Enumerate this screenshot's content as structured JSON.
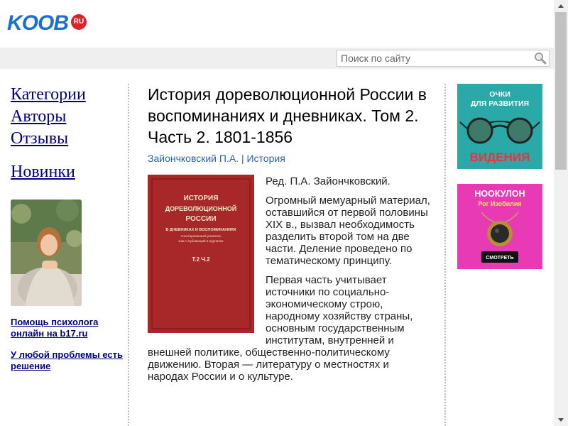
{
  "header": {
    "logo_text": "KOOB",
    "logo_badge": "RU",
    "search_placeholder": "Поиск по сайту"
  },
  "nav": {
    "items": [
      "Категории",
      "Авторы",
      "Отзывы"
    ],
    "new_label": "Новинки"
  },
  "promo": {
    "link1": "Помощь психолога онлайн на b17.ru",
    "link2": "У любой проблемы есть решение"
  },
  "book": {
    "title": "История дореволюционной России в воспоминаниях и дневниках. Том 2. Часть 2. 1801-1856",
    "author": "Зайончковский П.А.",
    "separator": "|",
    "category": "История",
    "cover_lines": [
      "ИСТОРИЯ",
      "ДОРЕВОЛЮЦИОННОЙ",
      "РОССИИ",
      "В ДНЕВНИКАХ И ВОСПОМИНАНИЯХ",
      "Аннотированный указатель",
      "книг и публикаций в журналах",
      "Т.2 Ч.2"
    ],
    "paragraphs": [
      "Ред. П.А. Зайончковский.",
      "Огромный мемуарный материал, оставшийся от первой половины XIX в., вызвал необходимость разделить второй том на две части. Деление проведено по тематическому принципу.",
      "Первая часть учитывает источники по социально-экономическому строю, народному хозяйству страны, основным государственным институтам, внутренней и внешней политике, общественно-политическому движению. Вторая — литературу о местностях и народах России и о культуре."
    ]
  },
  "ads": {
    "ad1": {
      "line1": "ОЧКИ",
      "line2": "ДЛЯ РАЗВИТИЯ",
      "line3": "ВИДЕНИЯ"
    },
    "ad2": {
      "title": "НООКУЛОН",
      "subtitle": "Рог Изобилия",
      "button": "СМОТРЕТЬ"
    }
  },
  "colors": {
    "logo_blue": "#1a6fd0",
    "link_navy": "#000080",
    "meta_blue": "#2b62a6",
    "ad1_bg": "#2ba8a8",
    "ad2_bg": "#e83ab5",
    "cover_red": "#a8282a"
  }
}
